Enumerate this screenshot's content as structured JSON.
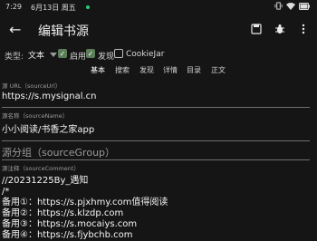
{
  "status": {
    "time": "7:29",
    "date": "6月13日 周五"
  },
  "appbar": {
    "back": "←",
    "title": "编辑书源"
  },
  "options": {
    "type_label": "类型:",
    "type_value": "文本",
    "enable_label": "启用",
    "discover_label": "发现",
    "cookiejar_label": "CookieJar"
  },
  "tabs": [
    "基本",
    "搜索",
    "发现",
    "详情",
    "目录",
    "正文"
  ],
  "fields": {
    "url_label": "源 URL（sourceUrl）",
    "url_value": "https://s.mysignal.cn",
    "name_label": "源名称（sourceName）",
    "name_value": "小小阅读/书香之家app",
    "group_placeholder": "源分组（sourceGroup）",
    "comment_label": "源注释（sourceComment）",
    "comment_lines": [
      "//20231225By_遇知",
      "/*",
      "备用①：https://s.pjxhmy.com值得阅读",
      "备用②：https://s.klzdp.com",
      "备用③：https://s.mocaiys.com",
      "备用④：https://s.fjybchb.com"
    ]
  },
  "colors": {
    "background": "#151515",
    "check_on": "#5b7d57"
  }
}
